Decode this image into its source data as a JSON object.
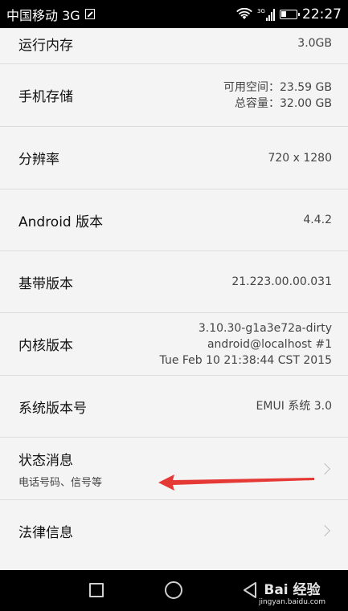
{
  "status_bar": {
    "carrier": "中国移动 3G",
    "network_tag": "3G",
    "time": "22:27"
  },
  "rows": [
    {
      "label": "运行内存",
      "value": "3.0GB"
    },
    {
      "label": "手机存储",
      "value_lines": [
        "可用空间：23.59 GB",
        "总容量：32.00 GB"
      ]
    },
    {
      "label": "分辨率",
      "value": "720 x 1280"
    },
    {
      "label": "Android 版本",
      "value": "4.4.2"
    },
    {
      "label": "基带版本",
      "value": "21.223.00.00.031"
    },
    {
      "label": "内核版本",
      "value_lines": [
        "3.10.30-g1a3e72a-dirty",
        "android@localhost #1",
        "Tue Feb 10 21:38:44 CST 2015"
      ]
    },
    {
      "label": "系统版本号",
      "value": "EMUI 系统 3.0"
    },
    {
      "label": "状态消息",
      "subtitle": "电话号码、信号等"
    },
    {
      "label": "法律信息"
    }
  ],
  "annotation_color": "#e53935",
  "watermark": {
    "brand": "Bai 经验",
    "url": "jingyan.baidu.com"
  }
}
